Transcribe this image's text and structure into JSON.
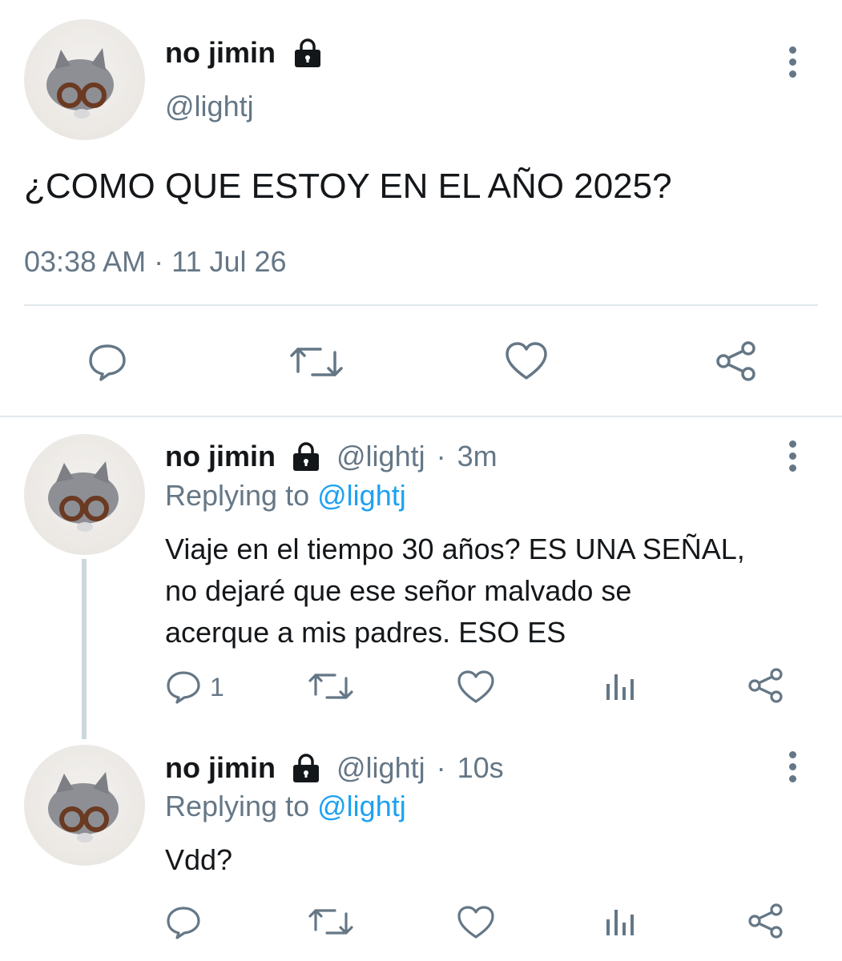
{
  "main_tweet": {
    "display_name": "no jimin",
    "handle": "@lightj",
    "text": "¿COMO QUE ESTOY EN EL AÑO 2025?",
    "timestamp": "03:38 AM · 11 Jul 26"
  },
  "replies": [
    {
      "display_name": "no jimin",
      "handle": "@lightj",
      "separator": "·",
      "age": "3m",
      "replying_prefix": "Replying to",
      "replying_handle": "@lightj",
      "text_lines": [
        "Viaje en el tiempo 30 años? ES UNA SEÑAL,",
        "no dejaré que ese señor malvado se",
        "acerque a mis padres. ESO ES"
      ],
      "reply_count": "1"
    },
    {
      "display_name": "no jimin",
      "handle": "@lightj",
      "separator": "·",
      "age": "10s",
      "replying_prefix": "Replying to",
      "replying_handle": "@lightj",
      "text_lines": [
        "Vdd?"
      ],
      "reply_count": ""
    }
  ],
  "icons": [
    "lock-icon",
    "more-icon",
    "reply-icon",
    "retweet-icon",
    "like-icon",
    "share-icon",
    "analytics-icon"
  ],
  "colors": {
    "text": "#14171a",
    "muted": "#657786",
    "link": "#1da1f2",
    "divider": "#e1e8ed"
  }
}
